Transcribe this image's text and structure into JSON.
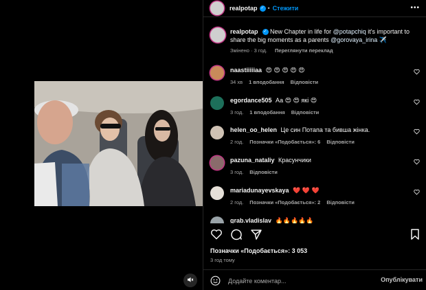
{
  "post": {
    "author": "realpotap",
    "follow_label": "Стежити",
    "dot": "•",
    "more": "•••"
  },
  "caption": {
    "username": "realpotap",
    "text_before": "New Chapter in life for",
    "mention1": "@potapchiq",
    "text_middle": "it's important to share the big moments as a parents",
    "mention2": "@gorovaya_irina",
    "emoji": "✈️",
    "edited": "Змінено · 3 год.",
    "translate": "Переглянути переклад"
  },
  "comments": [
    {
      "username": "naastiiiiiaa",
      "text": "😍 😍 😍 😍 😍",
      "time": "34 хв",
      "likes": "1 вподобання",
      "reply": "Відповісти",
      "avatar_color": "#c98a5a"
    },
    {
      "username": "egordance505",
      "text": "Аа 😍 😍 які 😍",
      "time": "3 год.",
      "likes": "1 вподобання",
      "reply": "Відповісти",
      "avatar_color": "#1d6f5a"
    },
    {
      "username": "helen_oo_helen",
      "text": "Це син Потапа та бивша жінка.",
      "time": "2 год.",
      "likes": "Позначки «Подобається»: 6",
      "reply": "Відповісти",
      "avatar_color": "#cfc2b4"
    },
    {
      "username": "pazuna_nataliy",
      "text": "Красунчики",
      "time": "3 год.",
      "likes": "",
      "reply": "Відповісти",
      "avatar_color": "#8a6b6b"
    },
    {
      "username": "mariadunayevskaya",
      "text": "❤️ ❤️ ❤️",
      "time": "2 год.",
      "likes": "Позначки «Подобається»: 2",
      "reply": "Відповісти",
      "avatar_color": "#e6e0d8"
    },
    {
      "username": "grab.vladislav",
      "text": "🔥🔥🔥🔥🔥",
      "time": "",
      "likes": "",
      "reply": "",
      "avatar_color": "#9aa3a8"
    }
  ],
  "footer": {
    "likes_label": "Позначки «Подобається»: 3 053",
    "time_ago": "3 год тому",
    "comment_placeholder": "Додайте коментар...",
    "post_label": "Опублікувати"
  },
  "colors": {
    "link_blue": "#0095f6",
    "verified": "#0095f6",
    "muted_text": "#a8a8a8",
    "background": "#000000"
  }
}
